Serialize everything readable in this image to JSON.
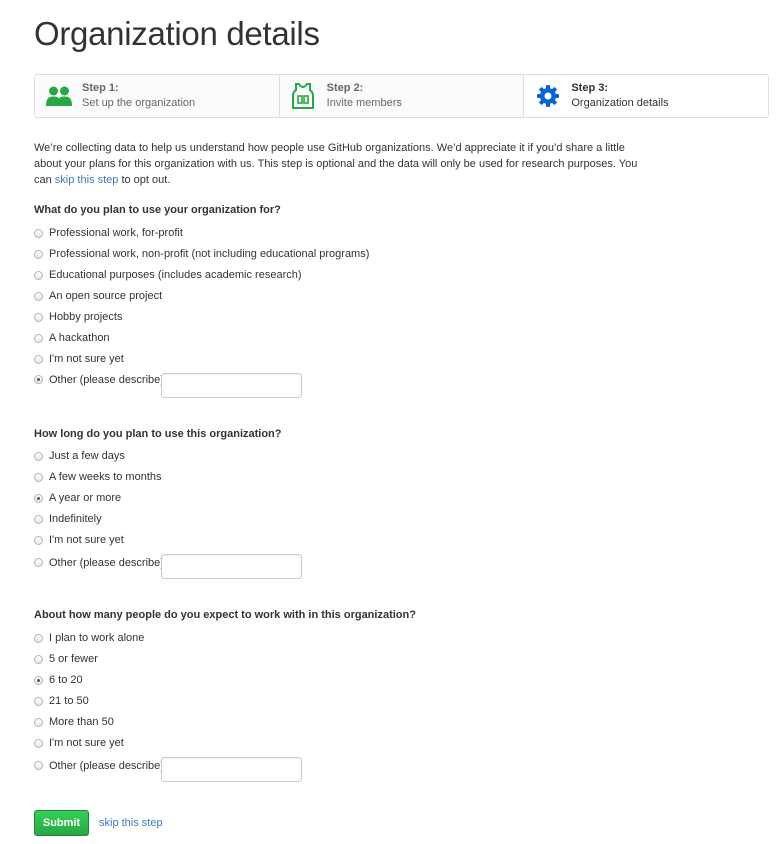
{
  "page": {
    "title": "Organization details"
  },
  "steps": [
    {
      "title": "Step 1:",
      "subtitle": "Set up the organization",
      "icon": "people-icon",
      "icon_color": "#28a745"
    },
    {
      "title": "Step 2:",
      "subtitle": "Invite members",
      "icon": "jersey-icon",
      "icon_color": "#28a745"
    },
    {
      "title": "Step 3:",
      "subtitle": "Organization details",
      "icon": "gear-icon",
      "icon_color": "#0366d6"
    }
  ],
  "intro": {
    "text_before": "We’re collecting data to help us understand how people use GitHub organizations. We’d appreciate it if you’d share a little about your plans for this organization with us. This step is optional and the data will only be used for research purposes. You can ",
    "link": "skip this step",
    "text_after": " to opt out."
  },
  "questions": [
    {
      "label": "What do you plan to use your organization for?",
      "options": [
        "Professional work, for-profit",
        "Professional work, non-profit (not including educational programs)",
        "Educational purposes (includes academic research)",
        "An open source project",
        "Hobby projects",
        "A hackathon",
        "I'm not sure yet",
        "Other (please describe)"
      ],
      "selected": "Other (please describe)",
      "other_value": ""
    },
    {
      "label": "How long do you plan to use this organization?",
      "options": [
        "Just a few days",
        "A few weeks to months",
        "A year or more",
        "Indefinitely",
        "I'm not sure yet",
        "Other (please describe)"
      ],
      "selected": "A year or more",
      "other_value": ""
    },
    {
      "label": "About how many people do you expect to work with in this organization?",
      "options": [
        "I plan to work alone",
        "5 or fewer",
        "6 to 20",
        "21 to 50",
        "More than 50",
        "I'm not sure yet",
        "Other (please describe)"
      ],
      "selected": "6 to 20",
      "other_value": ""
    }
  ],
  "actions": {
    "submit_label": "Submit",
    "skip_label": "skip this step"
  },
  "colors": {
    "accent": "#4078c0",
    "primary_button": "#28a745",
    "step_active_icon": "#0366d6"
  }
}
